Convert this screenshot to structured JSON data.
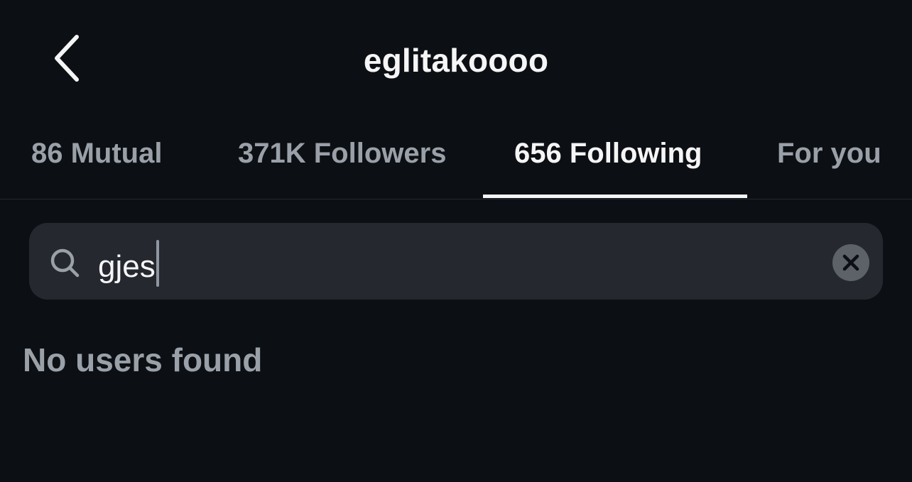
{
  "header": {
    "title": "eglitakoooo",
    "back_icon": "chevron-left-icon"
  },
  "tabs": [
    {
      "label": "86 Mutual",
      "active": false
    },
    {
      "label": "371K Followers",
      "active": false
    },
    {
      "label": "656 Following",
      "active": true
    },
    {
      "label": "For you",
      "active": false
    }
  ],
  "search": {
    "value": "gjes",
    "icon": "search-icon",
    "clear_icon": "clear-circle-icon"
  },
  "results": {
    "empty_message": "No users found"
  },
  "colors": {
    "background": "#0c0f14",
    "search_field": "#25282e",
    "muted_text": "#9aa0a8",
    "primary_text": "#f5f5f5"
  }
}
